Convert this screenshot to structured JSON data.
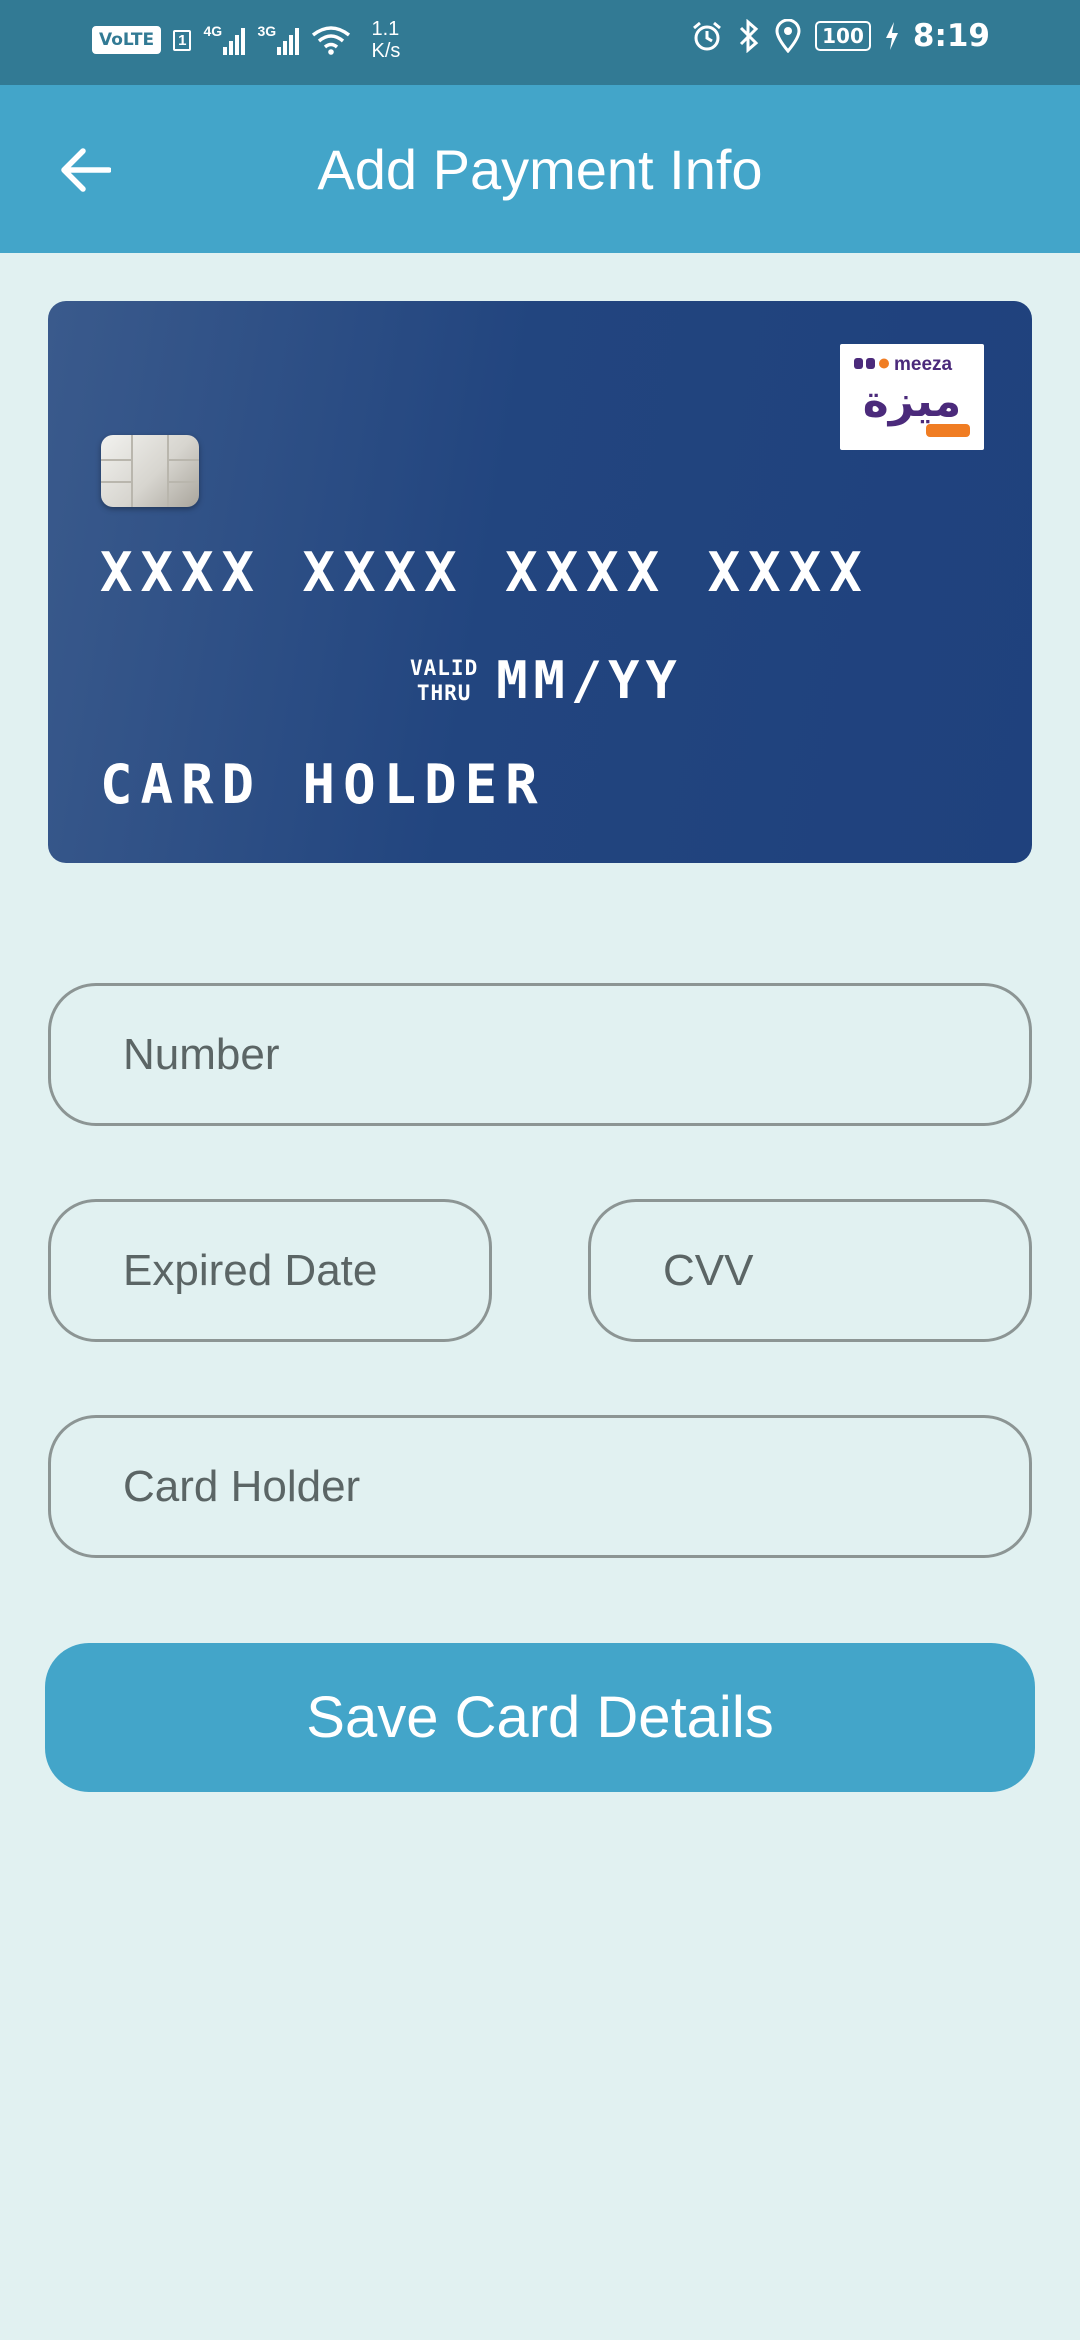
{
  "status_bar": {
    "volte": "VoLTE",
    "sim": "1",
    "net1": "4G",
    "net2": "3G",
    "speed_value": "1.1",
    "speed_unit": "K/s",
    "battery": "100",
    "time": "8:19",
    "icons": [
      "signal-icon",
      "wifi-icon",
      "alarm-icon",
      "bluetooth-icon",
      "location-icon",
      "battery-icon",
      "charging-icon"
    ]
  },
  "header": {
    "title": "Add Payment Info",
    "back_icon": "arrow-left-icon"
  },
  "card": {
    "number": "XXXX XXXX XXXX XXXX",
    "valid_line1": "VALID",
    "valid_line2": "THRU",
    "expiry": "MM/YY",
    "holder": "CARD HOLDER",
    "logo_latin": "meeza",
    "logo_arabic": "ميزة",
    "colors": {
      "gradient_start": "#3a5a8c",
      "gradient_end": "#1f417d"
    }
  },
  "form": {
    "number_placeholder": "Number",
    "expiry_placeholder": "Expired Date",
    "cvv_placeholder": "CVV",
    "holder_placeholder": "Card Holder"
  },
  "actions": {
    "save_label": "Save Card Details"
  },
  "colors": {
    "primary": "#43a5c9",
    "status_bar": "#327a94",
    "background": "#e1f1f1",
    "field_border": "#8c9594"
  }
}
